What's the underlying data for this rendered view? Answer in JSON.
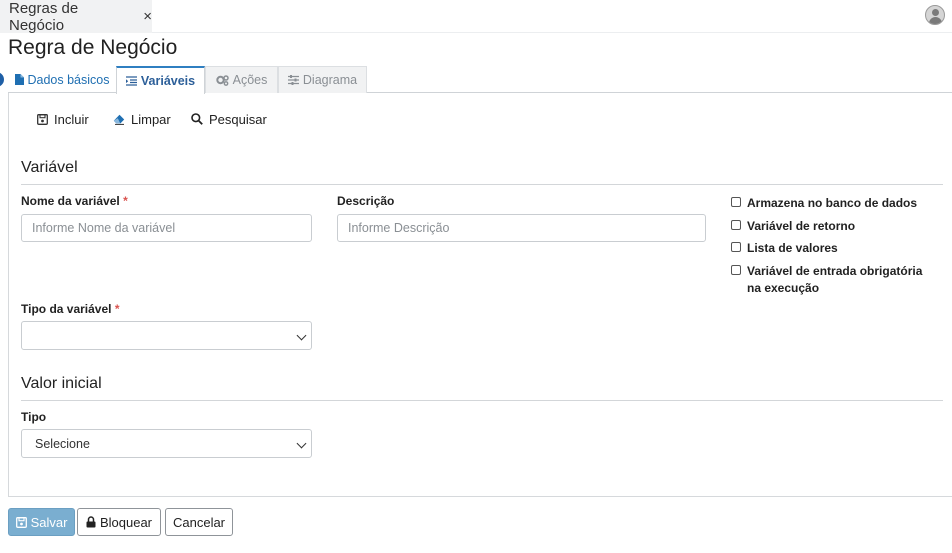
{
  "window": {
    "tab_title": "Regras de Negócio",
    "tab_close": "×"
  },
  "page": {
    "title": "Regra de Negócio"
  },
  "tabs": [
    {
      "label": "Dados básicos",
      "icon": "file-icon",
      "state": "link"
    },
    {
      "label": "Variáveis",
      "icon": "list-indent-icon",
      "state": "active"
    },
    {
      "label": "Ações",
      "icon": "gears-icon",
      "state": "disabled"
    },
    {
      "label": "Diagrama",
      "icon": "sliders-icon",
      "state": "disabled"
    }
  ],
  "toolbar": {
    "incluir": "Incluir",
    "limpar": "Limpar",
    "pesquisar": "Pesquisar"
  },
  "variavel_section": {
    "title": "Variável",
    "nome_label": "Nome da variável",
    "nome_required": "*",
    "nome_placeholder": "Informe Nome da variável",
    "nome_value": "",
    "descricao_label": "Descrição",
    "descricao_placeholder": "Informe Descrição",
    "descricao_value": "",
    "tipo_label": "Tipo da variável",
    "tipo_required": "*",
    "tipo_value": ""
  },
  "checkboxes": [
    {
      "label": "Armazena no banco de dados",
      "checked": false
    },
    {
      "label": "Variável de retorno",
      "checked": false
    },
    {
      "label": "Lista de valores",
      "checked": false
    },
    {
      "label": "Variável de entrada obrigatória na execução",
      "checked": false
    }
  ],
  "valor_inicial_section": {
    "title": "Valor inicial",
    "tipo_label": "Tipo",
    "tipo_value": "Selecione"
  },
  "footer": {
    "salvar": "Salvar",
    "bloquear": "Bloquear",
    "cancelar": "Cancelar"
  },
  "colors": {
    "accent": "#2f7fc1",
    "link": "#1f6fb2",
    "required": "#d9534f",
    "primary_button": "#7aaed0"
  }
}
